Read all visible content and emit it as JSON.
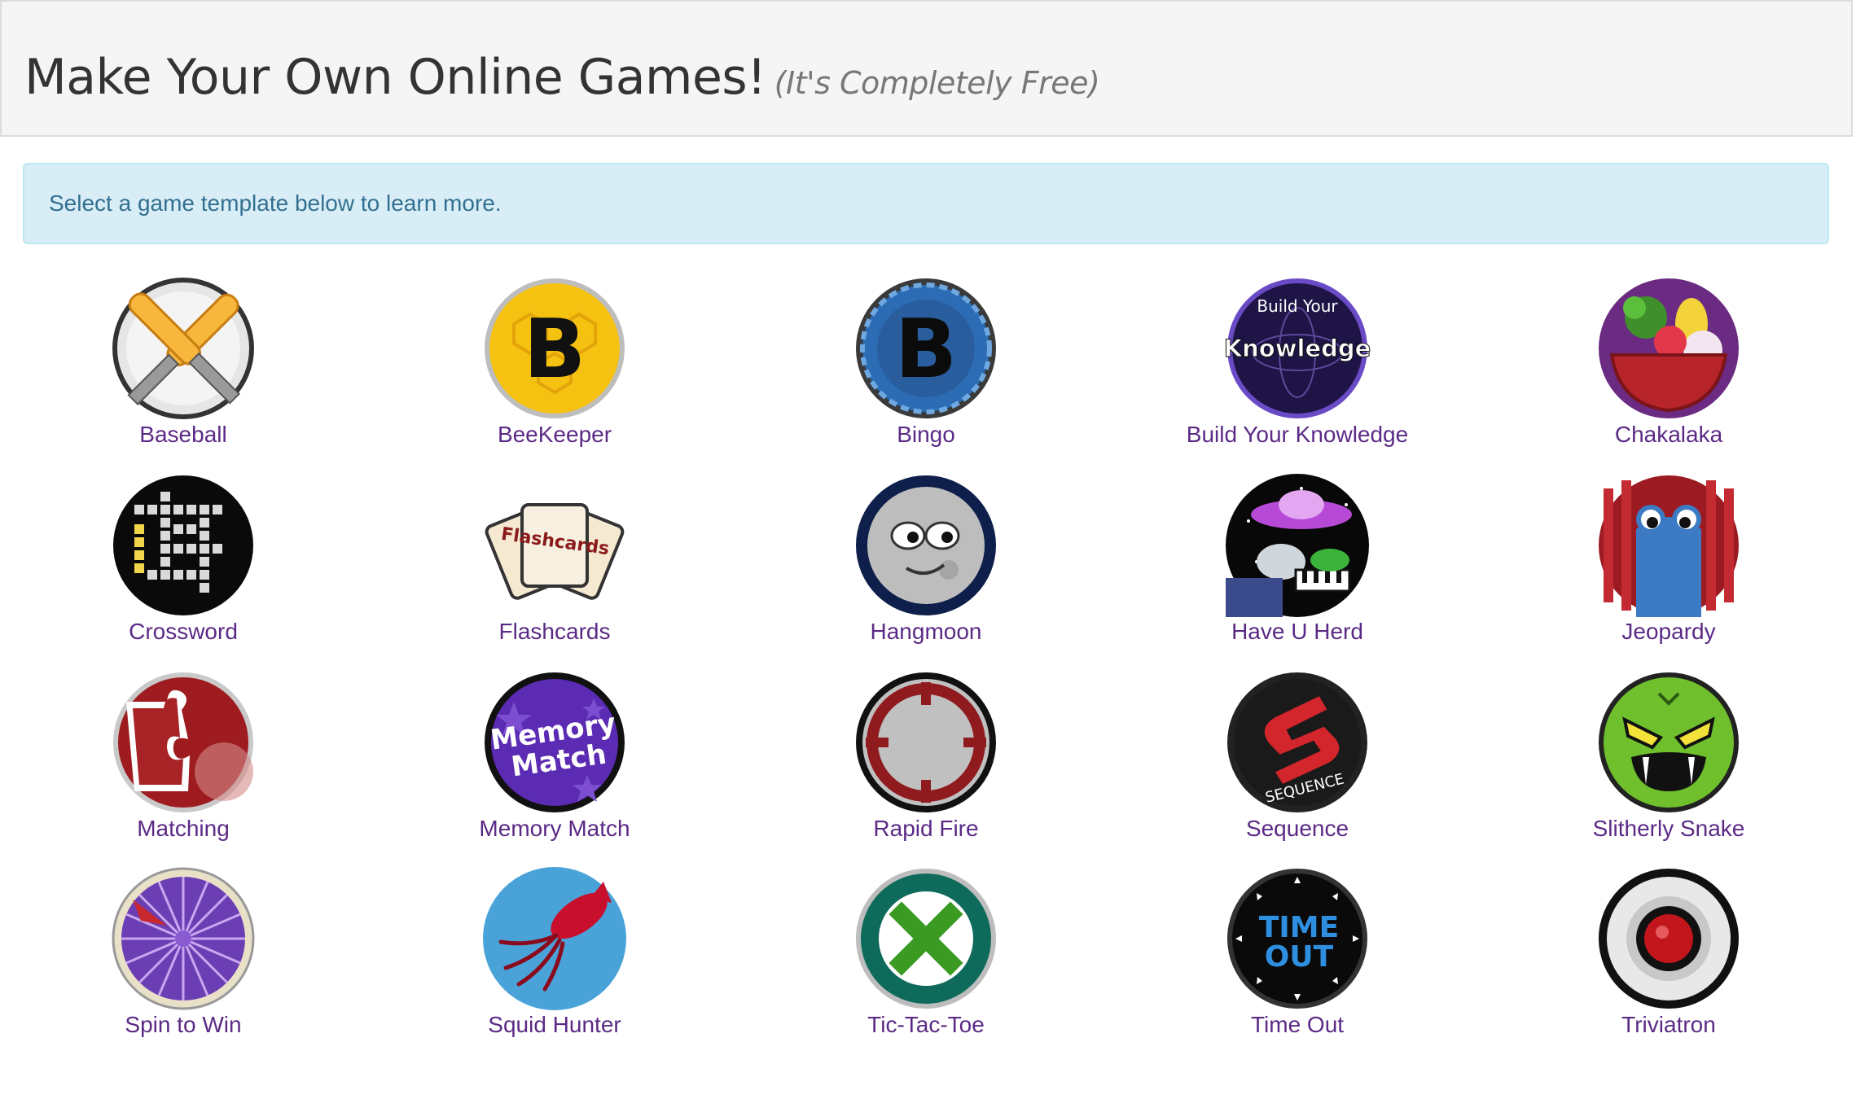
{
  "header": {
    "title": "Make Your Own Online Games!",
    "subtitle": "(It's Completely Free)"
  },
  "alert": {
    "text": "Select a game template below to learn more."
  },
  "games": [
    {
      "label": "Baseball",
      "icon": "baseball-bats-icon"
    },
    {
      "label": "BeeKeeper",
      "icon": "beekeeper-b-icon"
    },
    {
      "label": "Bingo",
      "icon": "bingo-b-icon"
    },
    {
      "label": "Build Your Knowledge",
      "icon": "build-your-knowledge-icon",
      "icon_text_top": "Build Your",
      "icon_text_main": "Knowledge"
    },
    {
      "label": "Chakalaka",
      "icon": "veggie-bowl-icon"
    },
    {
      "label": "Crossword",
      "icon": "crossword-grid-icon"
    },
    {
      "label": "Flashcards",
      "icon": "flashcards-icon",
      "icon_text": "Flashcards"
    },
    {
      "label": "Hangmoon",
      "icon": "moon-face-icon"
    },
    {
      "label": "Have U Herd",
      "icon": "ufo-cow-icon"
    },
    {
      "label": "Jeopardy",
      "icon": "blue-creature-icon"
    },
    {
      "label": "Matching",
      "icon": "puzzle-pieces-icon"
    },
    {
      "label": "Memory Match",
      "icon": "memory-match-icon",
      "icon_text_1": "Memory",
      "icon_text_2": "Match"
    },
    {
      "label": "Rapid Fire",
      "icon": "target-crosshair-icon"
    },
    {
      "label": "Sequence",
      "icon": "sequence-s-icon",
      "icon_text": "SEQUENCE"
    },
    {
      "label": "Slitherly Snake",
      "icon": "snake-face-icon"
    },
    {
      "label": "Spin to Win",
      "icon": "prize-wheel-icon"
    },
    {
      "label": "Squid Hunter",
      "icon": "squid-icon"
    },
    {
      "label": "Tic-Tac-Toe",
      "icon": "tic-tac-toe-x-icon"
    },
    {
      "label": "Time Out",
      "icon": "time-out-clock-icon",
      "icon_text_1": "TIME",
      "icon_text_2": "OUT"
    },
    {
      "label": "Triviatron",
      "icon": "red-button-icon"
    }
  ]
}
